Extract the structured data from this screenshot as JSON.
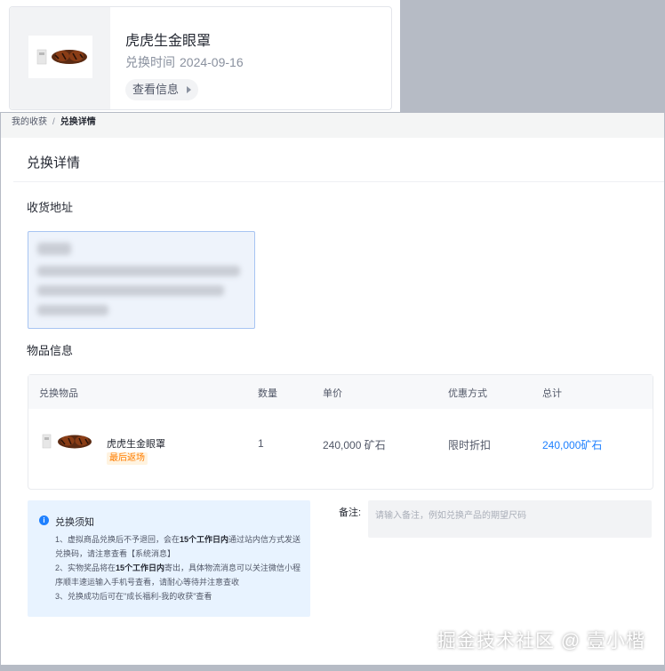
{
  "top_card": {
    "title": "虎虎生金眼罩",
    "date_label": "兑换时间",
    "date_value": "2024-09-16",
    "view_button": "查看信息"
  },
  "breadcrumb": {
    "parent": "我的收获",
    "separator": "/",
    "current": "兑换详情"
  },
  "detail": {
    "title": "兑换详情",
    "address_section": "收货地址",
    "items_section": "物品信息"
  },
  "table": {
    "headers": [
      "兑换物品",
      "数量",
      "单价",
      "优惠方式",
      "总计"
    ],
    "row": {
      "name": "虎虎生金眼罩",
      "tag": "最后返场",
      "quantity": "1",
      "unit_price": "240,000 矿石",
      "discount": "限时折扣",
      "total": "240,000矿石"
    }
  },
  "notice": {
    "title": "兑换须知",
    "line1_a": "1、虚拟商品兑换后不予退回，会在",
    "line1_b": "15个工作日内",
    "line1_c": "通过站内信方式发送兑换码，请注意查看【系统消息】",
    "line2_a": "2、实物奖品将在",
    "line2_b": "15个工作日内",
    "line2_c": "寄出，具体物流消息可以关注微信小程序顺丰速运输入手机号查看，请耐心等待并注意查收",
    "line3": "3、兑换成功后可在\"成长福利-我的收获\"查看"
  },
  "remark": {
    "label": "备注:",
    "placeholder": "请输入备注，例如兑换产品的期望尺码"
  },
  "watermark": "掘金技术社区 @ 壹小楷",
  "colors": {
    "accent": "#1e80ff",
    "tag_orange": "#ff7d00",
    "notice_bg": "#e8f3ff",
    "address_border": "#a7c4f2"
  }
}
